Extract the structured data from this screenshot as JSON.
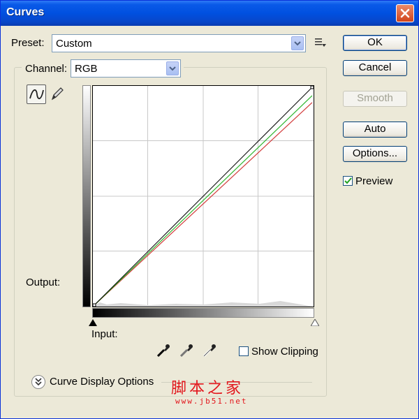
{
  "window": {
    "title": "Curves"
  },
  "preset": {
    "label": "Preset:",
    "value": "Custom"
  },
  "channel": {
    "label": "Channel:",
    "value": "RGB"
  },
  "buttons": {
    "ok": "OK",
    "cancel": "Cancel",
    "smooth": "Smooth",
    "auto": "Auto",
    "options": "Options..."
  },
  "preview": {
    "label": "Preview",
    "checked": true
  },
  "graph": {
    "output_label": "Output:",
    "input_label": "Input:"
  },
  "show_clipping": {
    "label": "Show Clipping",
    "checked": false
  },
  "curve_display_options": {
    "label": "Curve Display Options"
  },
  "watermark": {
    "text": "脚本之家",
    "url": "www.jb51.net"
  },
  "colors": {
    "title_bar": "#0a5ae8",
    "window_bg": "#ece9d8",
    "rgb_curve": "#000000",
    "green_curve": "#2db52d",
    "red_curve": "#d23a3a"
  },
  "icons": [
    "close-icon",
    "preset-menu-icon",
    "curve-tool-icon",
    "pencil-tool-icon",
    "black-eyedropper-icon",
    "gray-eyedropper-icon",
    "white-eyedropper-icon",
    "chevron-down-icon"
  ]
}
